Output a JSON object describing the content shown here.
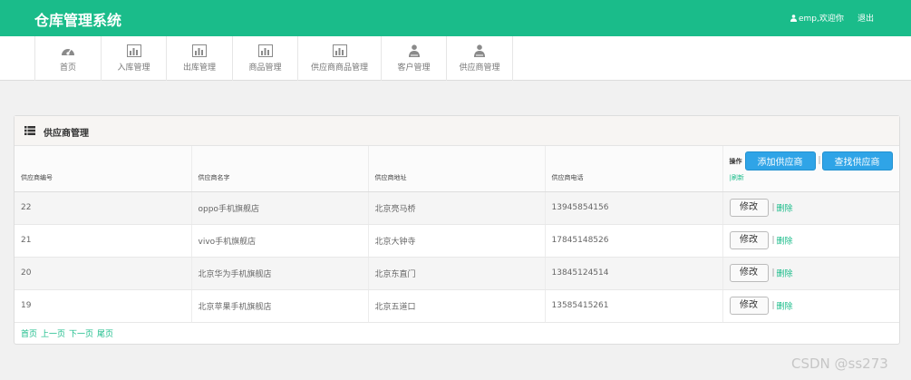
{
  "header": {
    "brand": "仓库管理系统",
    "user": "emp,欢迎你",
    "logout": "退出",
    "bg_color": "#1abc8a"
  },
  "nav": {
    "items": [
      {
        "label": "首页",
        "icon": "dashboard-icon"
      },
      {
        "label": "入库管理",
        "icon": "bar-chart-icon"
      },
      {
        "label": "出库管理",
        "icon": "bar-chart-icon"
      },
      {
        "label": "商品管理",
        "icon": "bar-chart-icon"
      },
      {
        "label": "供应商商品管理",
        "icon": "bar-chart-icon"
      },
      {
        "label": "客户管理",
        "icon": "users-icon"
      },
      {
        "label": "供应商管理",
        "icon": "users-icon"
      }
    ]
  },
  "panel": {
    "title": "供应商管理",
    "columns": [
      "供应商编号",
      "供应商名字",
      "供应商地址",
      "供应商电话"
    ],
    "ops": {
      "label": "操作",
      "add": "添加供应商",
      "sep": "|",
      "find": "查找供应商",
      "refresh": "|刷新"
    },
    "rows": [
      {
        "id": "22",
        "name": "oppo手机旗舰店",
        "address": "北京亮马桥",
        "phone": "13945854156"
      },
      {
        "id": "21",
        "name": "vivo手机旗舰店",
        "address": "北京大钟寺",
        "phone": "17845148526"
      },
      {
        "id": "20",
        "name": "北京华为手机旗舰店",
        "address": "北京东直门",
        "phone": "13845124514"
      },
      {
        "id": "19",
        "name": "北京苹果手机旗舰店",
        "address": "北京五道口",
        "phone": "13585415261"
      }
    ],
    "row_actions": {
      "edit": "修改",
      "sep": "|",
      "delete": "删除"
    },
    "pager": {
      "first": "首页",
      "prev": "上一页",
      "next": "下一页",
      "last": "尾页"
    }
  },
  "watermark": "CSDN @ss273"
}
